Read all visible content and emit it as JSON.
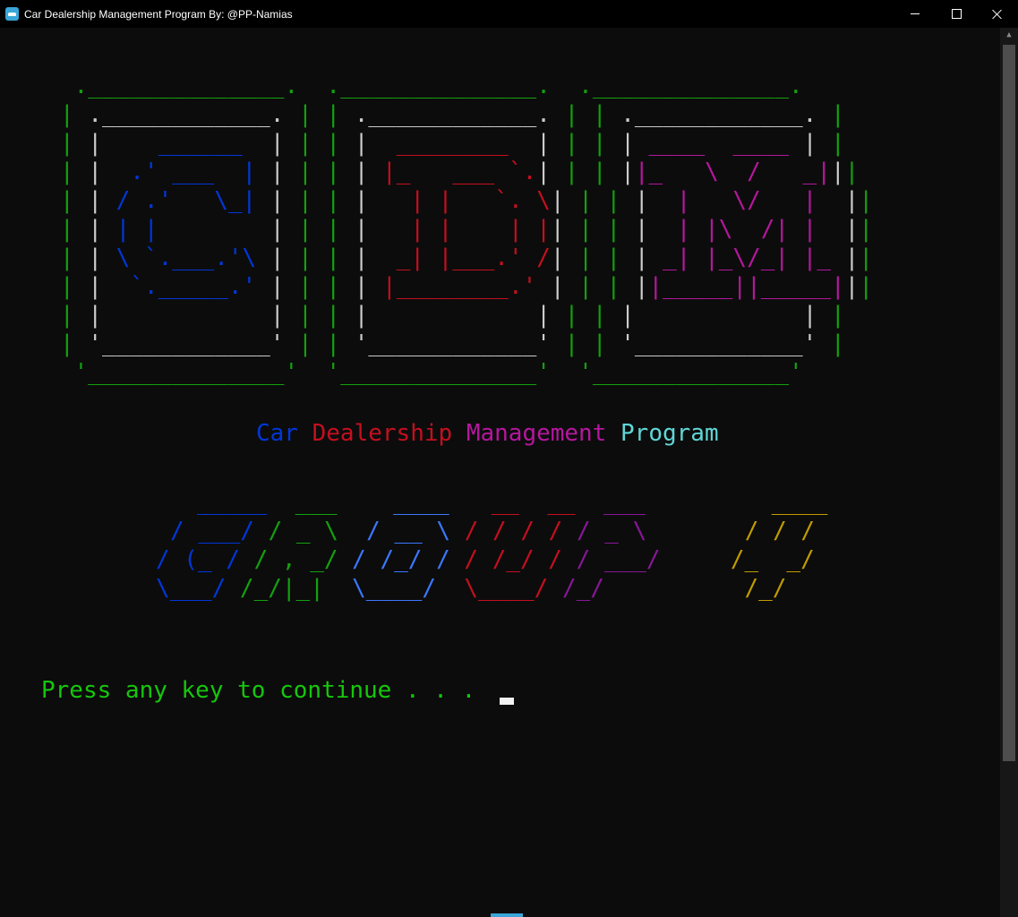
{
  "window": {
    "title": "Car Dealership Management Program By: @PP-Namias"
  },
  "icons": {
    "app": "terminal-app-icon",
    "minimize": "minimize-icon",
    "maximize": "maximize-icon",
    "close": "close-icon",
    "scroll_up": "arrow-up-icon"
  },
  "banner": {
    "frames": [
      {
        "letter": "C",
        "color": "#0037da"
      },
      {
        "letter": "D",
        "color": "#c50f1f"
      },
      {
        "letter": "M",
        "color": "#b5179e"
      }
    ],
    "frame_color": "#13a10e",
    "inner_frame_color": "#cccccc"
  },
  "subtitle": {
    "word1": "Car",
    "word2": "Dealership",
    "word3": "Management",
    "word4": "Program"
  },
  "group_logo": {
    "text": "GROUP 4"
  },
  "prompt": {
    "text": "Press any key to continue . . . "
  }
}
